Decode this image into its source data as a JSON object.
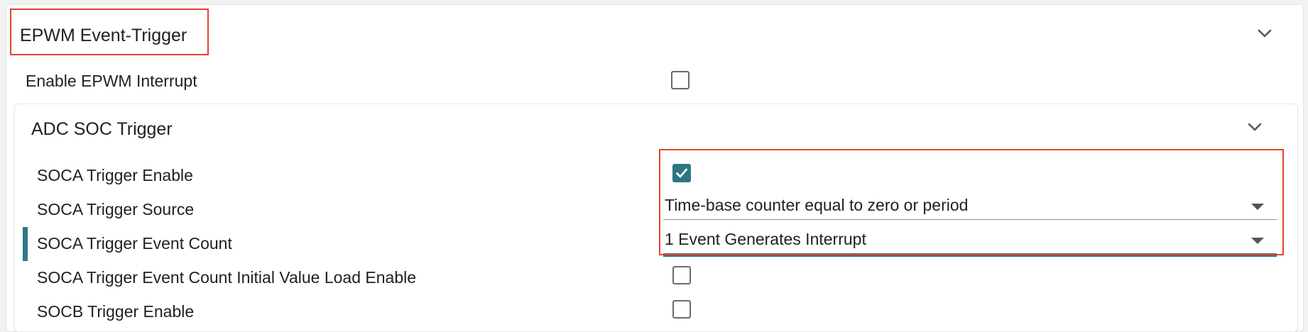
{
  "event_trigger": {
    "title": "EPWM Event-Trigger",
    "enable_interrupt_label": "Enable EPWM Interrupt",
    "enable_interrupt_checked": false
  },
  "adc_soc": {
    "title": "ADC SOC Trigger",
    "rows": [
      {
        "label": "SOCA Trigger Enable",
        "control": "checkbox",
        "checked": true
      },
      {
        "label": "SOCA Trigger Source",
        "control": "select",
        "value": "Time-base counter equal to zero or period"
      },
      {
        "label": "SOCA Trigger Event Count",
        "control": "select",
        "value": "1 Event Generates Interrupt"
      },
      {
        "label": "SOCA Trigger Event Count Initial Value Load Enable",
        "control": "checkbox",
        "checked": false
      },
      {
        "label": "SOCB Trigger Enable",
        "control": "checkbox",
        "checked": false
      }
    ]
  },
  "colors": {
    "accent": "#2f7584",
    "highlight": "#e0452a"
  },
  "icons": [
    "chevron-down-icon",
    "checkmark-icon",
    "dropdown-arrow-icon"
  ]
}
